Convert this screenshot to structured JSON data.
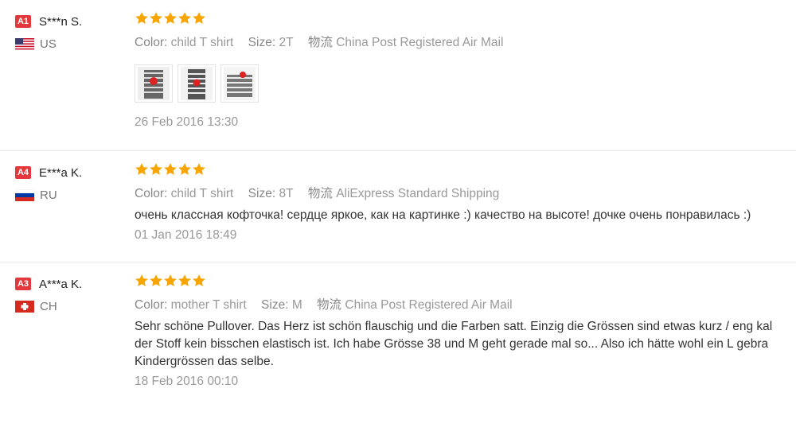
{
  "reviews": [
    {
      "level": "A1",
      "user": "S***n S.",
      "country": "US",
      "flag": "us-flag",
      "color_label": "Color:",
      "color_value": "child T shirt",
      "size_label": "Size:",
      "size_value": "2T",
      "logistics_label": "物流",
      "logistics_value": "China Post Registered Air Mail",
      "text": "",
      "photos": [
        "photo-1",
        "photo-2",
        "photo-3"
      ],
      "date": "26 Feb 2016 13:30",
      "rating": 5
    },
    {
      "level": "A4",
      "user": "E***a K.",
      "country": "RU",
      "flag": "ru-flag",
      "color_label": "Color:",
      "color_value": "child T shirt",
      "size_label": "Size:",
      "size_value": "8T",
      "logistics_label": "物流",
      "logistics_value": "AliExpress Standard Shipping",
      "text": "очень классная кофточка! сердце яркое, как на картинке :) качество на высоте! дочке очень понравилась :)",
      "date": "01 Jan 2016 18:49",
      "rating": 5
    },
    {
      "level": "A3",
      "user": "A***a K.",
      "country": "CH",
      "flag": "ch-flag",
      "color_label": "Color:",
      "color_value": "mother T shirt",
      "size_label": "Size:",
      "size_value": "M",
      "logistics_label": "物流",
      "logistics_value": "China Post Registered Air Mail",
      "text_lines": [
        "Sehr schöne Pullover. Das Herz ist schön flauschig und die Farben satt. Einzig die Grössen sind etwas kurz / eng kal",
        "der Stoff kein bisschen elastisch ist. Ich habe Grösse 38 und M geht gerade mal so... Also ich hätte wohl ein L gebra",
        "Kindergrössen das selbe."
      ],
      "date": "18 Feb 2016 00:10",
      "rating": 5
    }
  ],
  "colors": {
    "star": "#f7a500",
    "level_badge": "#e4393c"
  }
}
